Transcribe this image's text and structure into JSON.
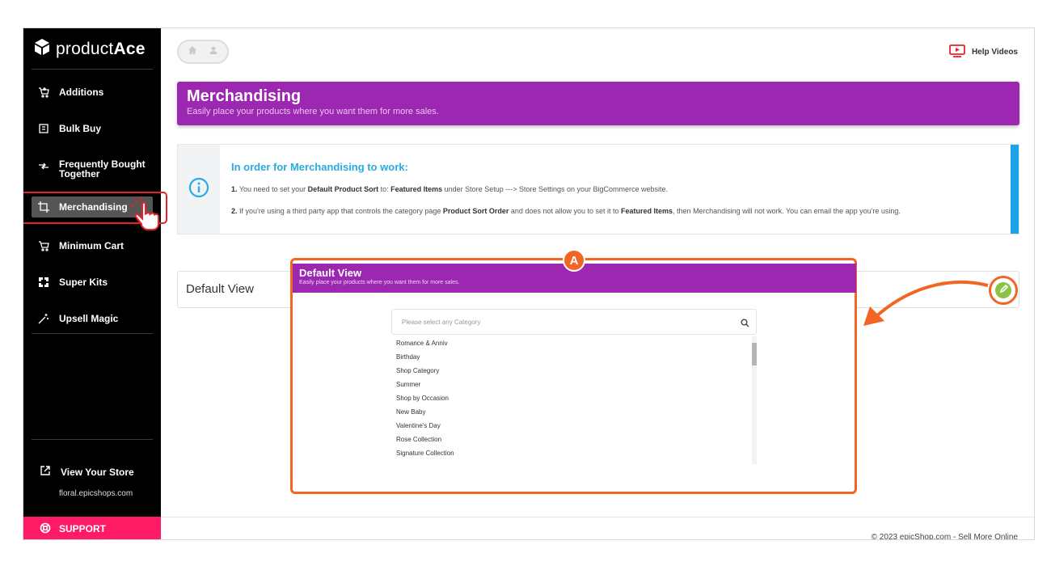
{
  "app": {
    "brand_light": "product",
    "brand_bold": "Ace"
  },
  "sidebar": {
    "items": [
      {
        "label": "Additions",
        "icon": "cart-plus-icon"
      },
      {
        "label": "Bulk Buy",
        "icon": "box-icon"
      },
      {
        "label": "Frequently Bought",
        "label2": "Together",
        "icon": "arrows-icon"
      },
      {
        "label": "Merchandising",
        "icon": "crop-icon",
        "active": true
      },
      {
        "label": "Minimum Cart",
        "icon": "cart-icon"
      },
      {
        "label": "Super Kits",
        "icon": "kit-icon"
      },
      {
        "label": "Upsell Magic",
        "icon": "wand-icon"
      }
    ],
    "store_label": "View Your Store",
    "store_url": "floral.epicshops.com",
    "support_label": "SUPPORT"
  },
  "header": {
    "help_label": "Help Videos"
  },
  "banner": {
    "title": "Merchandising",
    "subtitle": "Easily place your products where you want them for more sales."
  },
  "info": {
    "title": "In order for Merchandising to work:",
    "line1": {
      "num": "1.",
      "a": "You need to set your ",
      "b": "Default Product Sort",
      "c": " to: ",
      "d": "Featured Items",
      "e": " under Store Setup ---> Store Settings on your BigCommerce website."
    },
    "line2": {
      "num": "2.",
      "a": "If you're using a third party app that controls the category page ",
      "b": "Product Sort Order",
      "c": " and does not allow you to set it to ",
      "d": "Featured Items",
      "e": ", then Merchandising will not work. You can email the app you're using."
    }
  },
  "default_view": {
    "label": "Default View"
  },
  "popup": {
    "badge": "A",
    "title": "Default View",
    "subtitle": "Easily place your products where you want them for more sales.",
    "search_placeholder": "Please select any Category",
    "categories": [
      "Romance & Anniv",
      "Birthday",
      "Shop Category",
      "Summer",
      "Shop by Occasion",
      "New Baby",
      "Valentine's Day",
      "Rose Collection",
      "Signature Collection"
    ]
  },
  "footer": {
    "copyright": "© 2023 epicShop.com - Sell More Online"
  },
  "colors": {
    "purple": "#9c27b0",
    "info_blue": "#29abe2",
    "support": "#ff1a66",
    "annotation": "#f26522",
    "highlight": "#e8202a",
    "edit_green": "#8bc34a"
  }
}
